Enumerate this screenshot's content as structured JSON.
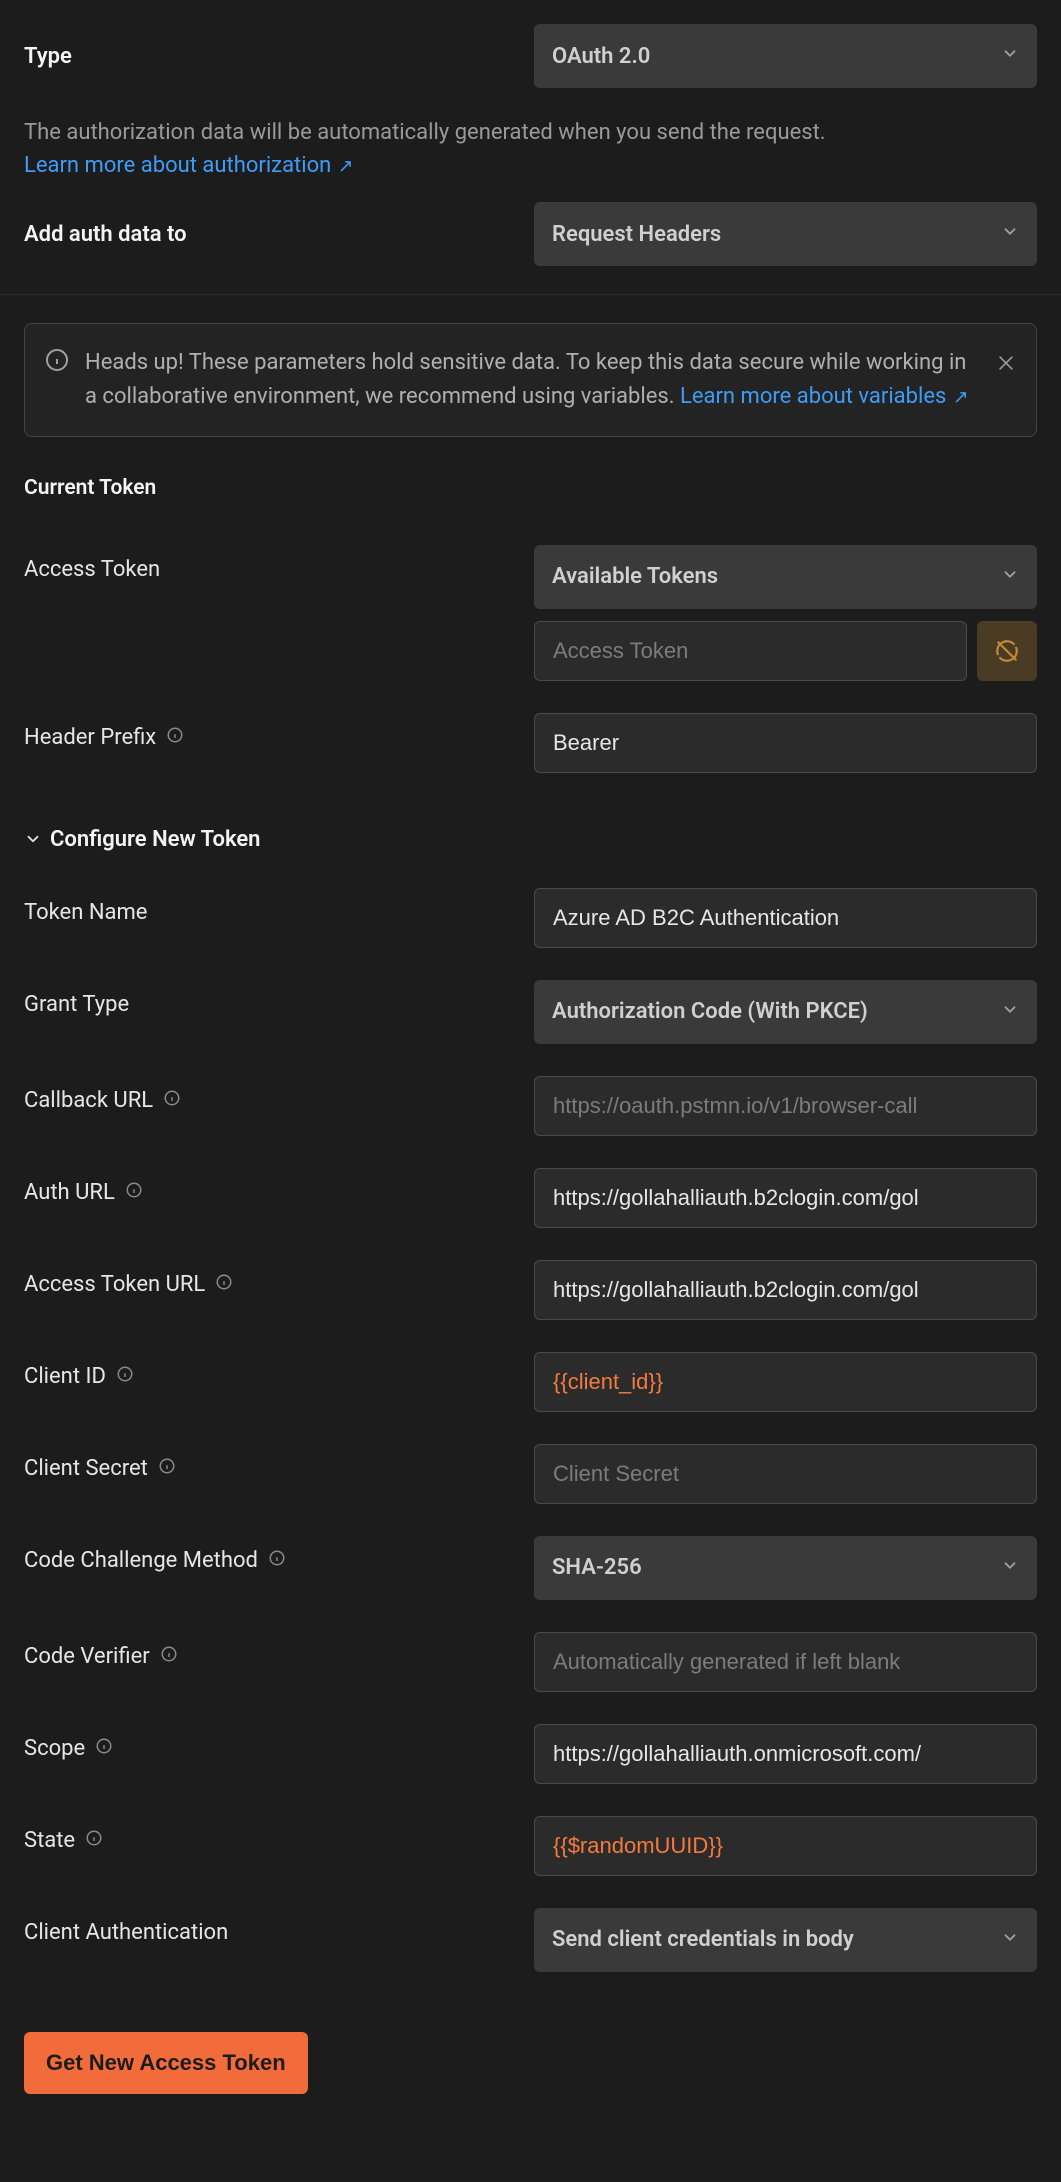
{
  "top": {
    "type_label": "Type",
    "type_value": "OAuth 2.0",
    "desc": "The authorization data will be automatically generated when you send the request.",
    "learn_more_auth": "Learn more about authorization",
    "add_auth_label": "Add auth data to",
    "add_auth_value": "Request Headers"
  },
  "alert": {
    "text": "Heads up! These parameters hold sensitive data. To keep this data secure while working in a collaborative environment, we recommend using variables. ",
    "link": "Learn more about variables"
  },
  "current_token": {
    "section_label": "Current Token",
    "access_token_label": "Access Token",
    "available_tokens": "Available Tokens",
    "access_token_placeholder": "Access Token",
    "header_prefix_label": "Header Prefix",
    "header_prefix_value": "Bearer"
  },
  "configure": {
    "header": "Configure New Token",
    "token_name_label": "Token Name",
    "token_name_value": "Azure AD B2C Authentication",
    "grant_type_label": "Grant Type",
    "grant_type_value": "Authorization Code (With PKCE)",
    "callback_url_label": "Callback URL",
    "callback_url_placeholder": "https://oauth.pstmn.io/v1/browser-call",
    "auth_url_label": "Auth URL",
    "auth_url_value": "https://gollahalliauth.b2clogin.com/gol",
    "access_token_url_label": "Access Token URL",
    "access_token_url_value": "https://gollahalliauth.b2clogin.com/gol",
    "client_id_label": "Client ID",
    "client_id_value": "{{client_id}}",
    "client_secret_label": "Client Secret",
    "client_secret_placeholder": "Client Secret",
    "code_challenge_label": "Code Challenge Method",
    "code_challenge_value": "SHA-256",
    "code_verifier_label": "Code Verifier",
    "code_verifier_placeholder": "Automatically generated if left blank",
    "scope_label": "Scope",
    "scope_value": "https://gollahalliauth.onmicrosoft.com/",
    "state_label": "State",
    "state_value": "{{$randomUUID}}",
    "client_auth_label": "Client Authentication",
    "client_auth_value": "Send client credentials in body"
  },
  "button": {
    "get_token": "Get New Access Token"
  }
}
